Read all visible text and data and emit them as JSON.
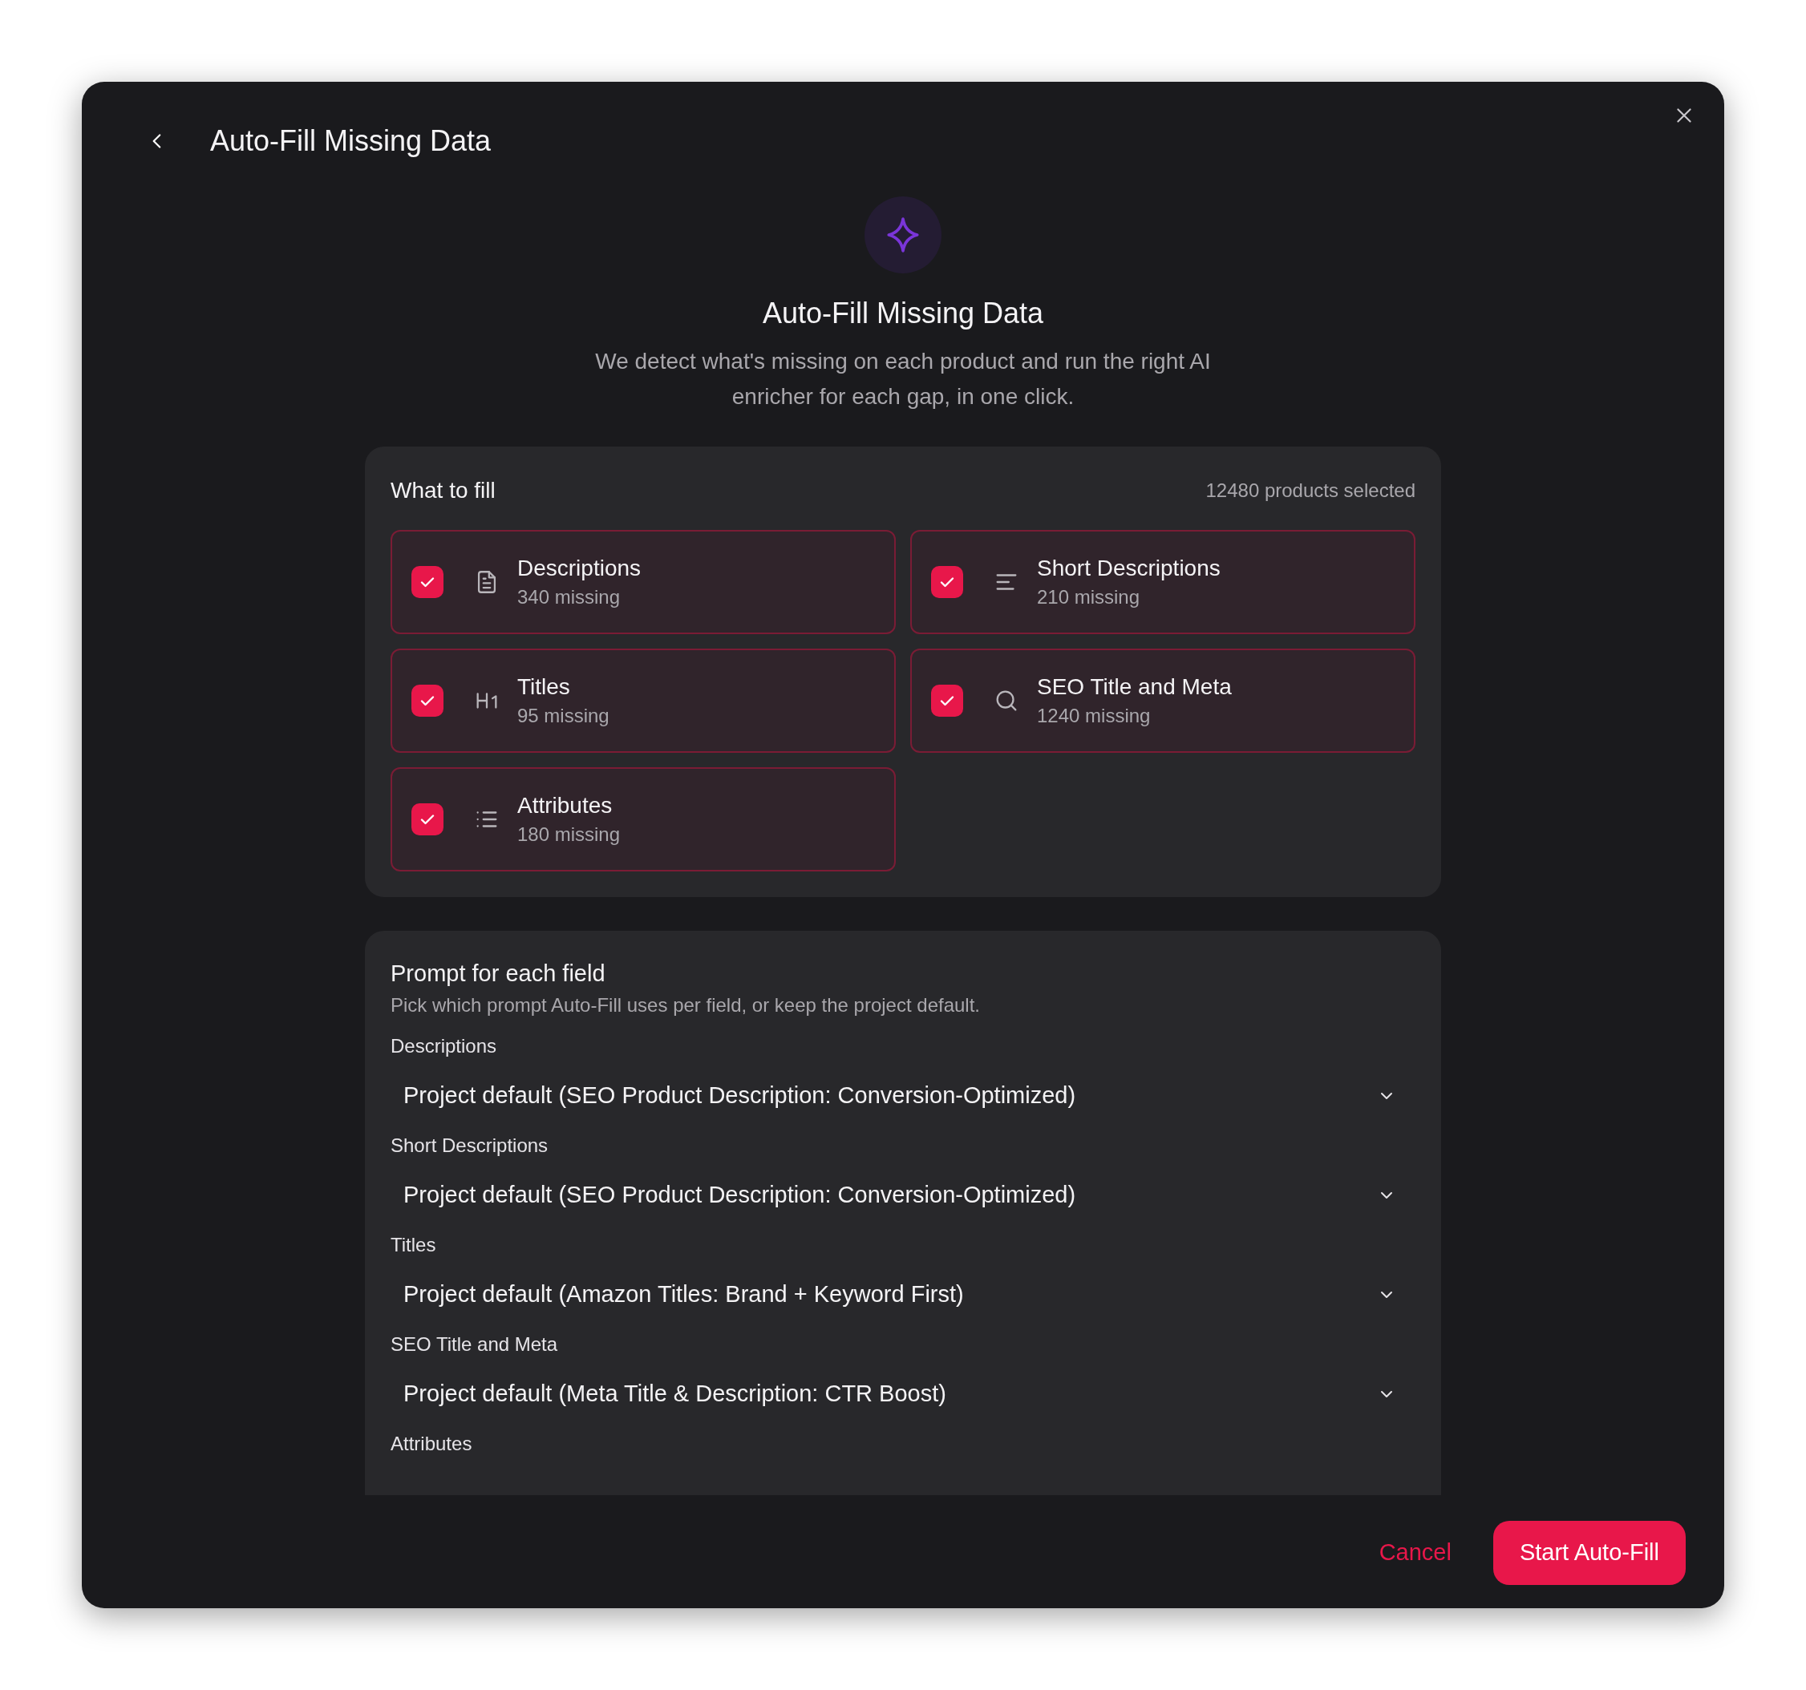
{
  "dialog": {
    "title": "Auto-Fill Missing Data",
    "heading": "Auto-Fill Missing Data",
    "description": "We detect what's missing on each product and run the right AI enricher for each gap, in one click."
  },
  "fill": {
    "title": "What to fill",
    "count": "12480 products selected",
    "options": [
      {
        "kind": "document",
        "label": "Descriptions",
        "missing": "340 missing",
        "checked": true
      },
      {
        "kind": "lines",
        "label": "Short Descriptions",
        "missing": "210 missing",
        "checked": true
      },
      {
        "kind": "heading",
        "label": "Titles",
        "missing": "95 missing",
        "checked": true
      },
      {
        "kind": "search",
        "label": "SEO Title and Meta",
        "missing": "1240 missing",
        "checked": true
      },
      {
        "kind": "list",
        "label": "Attributes",
        "missing": "180 missing",
        "checked": true
      }
    ]
  },
  "prompts": {
    "title": "Prompt for each field",
    "description": "Pick which prompt Auto-Fill uses per field, or keep the project default.",
    "fields": [
      {
        "label": "Descriptions",
        "value": "Project default (SEO Product Description: Conversion-Optimized)"
      },
      {
        "label": "Short Descriptions",
        "value": "Project default (SEO Product Description: Conversion-Optimized)"
      },
      {
        "label": "Titles",
        "value": "Project default (Amazon Titles: Brand + Keyword First)"
      },
      {
        "label": "SEO Title and Meta",
        "value": "Project default (Meta Title & Description: CTR Boost)"
      },
      {
        "label": "Attributes"
      }
    ]
  },
  "buttons": {
    "cancel": "Cancel",
    "start": "Start Auto-Fill"
  }
}
